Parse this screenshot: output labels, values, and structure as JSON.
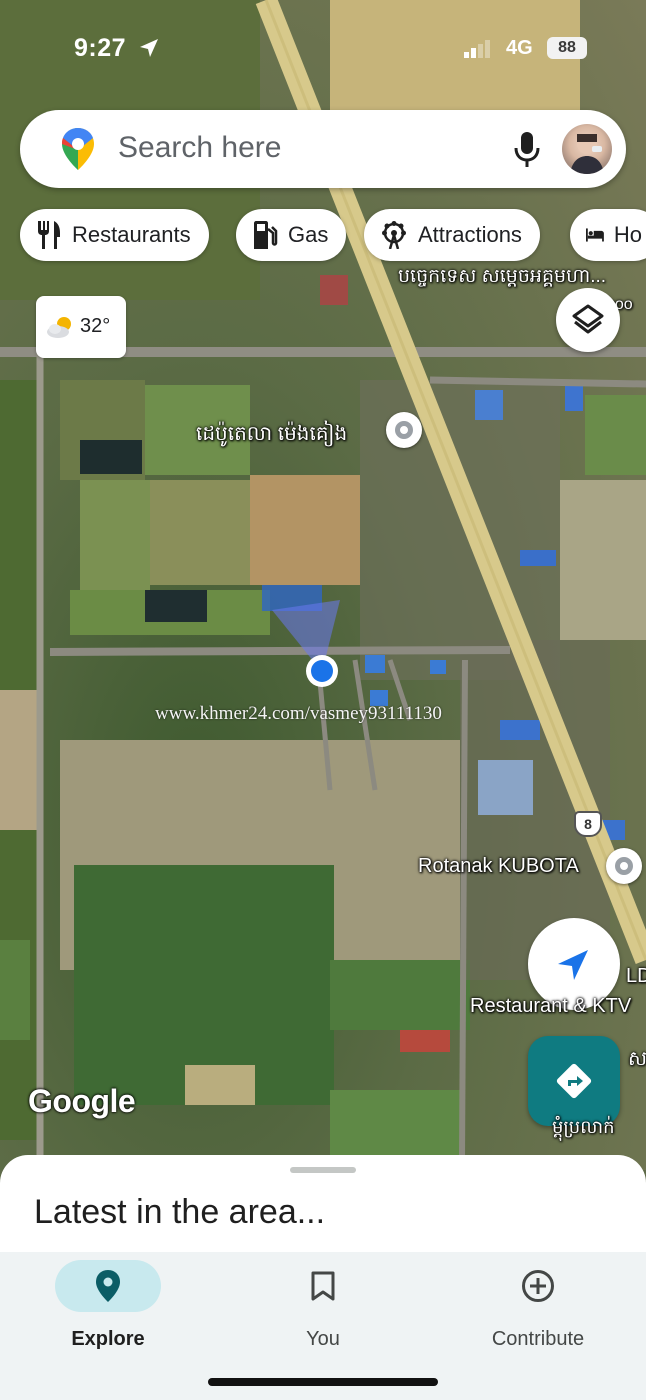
{
  "status_bar": {
    "time": "9:27",
    "network": "4G",
    "battery": "88"
  },
  "search": {
    "placeholder": "Search here"
  },
  "chips": [
    {
      "label": "Restaurants",
      "icon": "fork-knife-icon"
    },
    {
      "label": "Gas",
      "icon": "gas-pump-icon"
    },
    {
      "label": "Attractions",
      "icon": "ferris-wheel-icon"
    },
    {
      "label": "Ho",
      "icon": "bed-icon"
    }
  ],
  "weather": {
    "temp": "32°",
    "icon": "partly-cloudy-icon"
  },
  "map": {
    "labels": {
      "place_top": "បច្ចេកទេស សម្តេចអគ្គមហា...",
      "place_top_suffix": "hoo",
      "depot": "ដេប៉ូតេលា ម៉េងគៀង",
      "kubota": "Rotanak KUBOTA",
      "restaurant": "Restaurant & KTV",
      "restaurant_prefix": "LD",
      "khmer_bottom": "ស",
      "khmer_bottom2": "ម្តុំប្រលាក់"
    },
    "route_shield": "8",
    "watermark": "www.khmer24.com/vasmey93111130",
    "google_logo": "Google",
    "colors": {
      "road": "#d7c98b",
      "location_dot": "#1a73e8",
      "directions_fab": "#0f7b81"
    }
  },
  "sheet": {
    "title": "Latest in the area..."
  },
  "nav": [
    {
      "label": "Explore",
      "icon": "explore-pin-icon",
      "active": true
    },
    {
      "label": "You",
      "icon": "bookmark-icon",
      "active": false
    },
    {
      "label": "Contribute",
      "icon": "add-circle-icon",
      "active": false
    }
  ]
}
